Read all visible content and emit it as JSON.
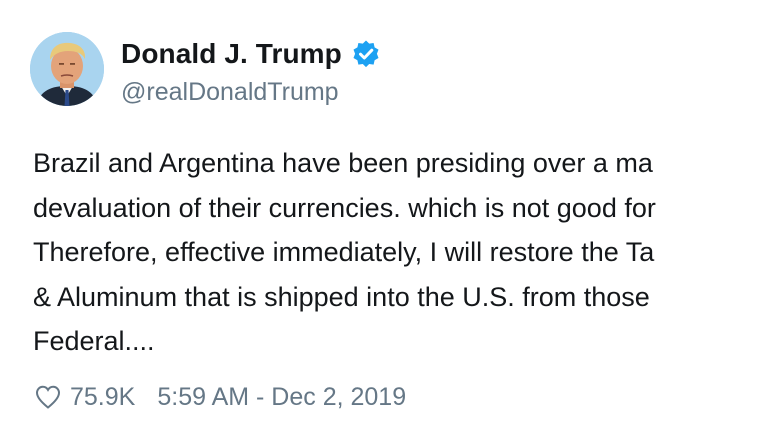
{
  "author": {
    "display_name": "Donald J. Trump",
    "handle": "@realDonaldTrump",
    "verified": true,
    "verified_icon": "verified-badge-icon",
    "accent_color": "#1da1f2"
  },
  "tweet": {
    "lines": [
      "Brazil and Argentina have been presiding over a ma",
      "devaluation of their currencies. which is not good for",
      "Therefore, effective immediately, I will restore the Ta",
      "& Aluminum that is shipped into the U.S. from those",
      "Federal...."
    ]
  },
  "meta": {
    "like_icon": "heart-icon",
    "like_count": "75.9K",
    "timestamp": "5:59 AM - Dec 2, 2019"
  }
}
